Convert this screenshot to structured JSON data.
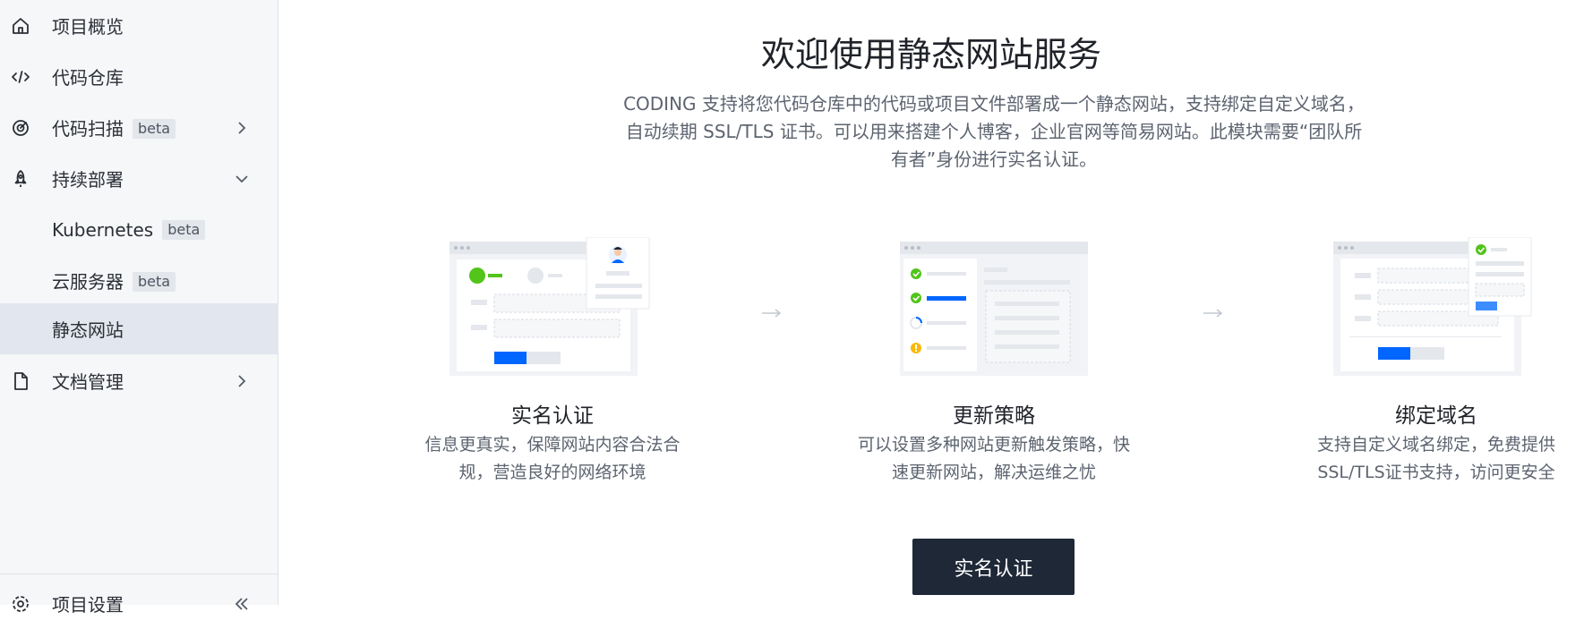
{
  "sidebar": {
    "items": [
      {
        "label": "项目概览",
        "icon": "home-icon"
      },
      {
        "label": "代码仓库",
        "icon": "code-icon"
      },
      {
        "label": "代码扫描",
        "badge": "beta",
        "icon": "scan-icon"
      },
      {
        "label": "持续部署",
        "icon": "rocket-icon"
      },
      {
        "label": "Kubernetes",
        "badge": "beta"
      },
      {
        "label": "云服务器",
        "badge": "beta"
      },
      {
        "label": "静态网站",
        "active": true
      },
      {
        "label": "文档管理",
        "icon": "document-icon"
      },
      {
        "label": "项目设置",
        "icon": "settings-icon"
      }
    ]
  },
  "main": {
    "title": "欢迎使用静态网站服务",
    "intro": "CODING 支持将您代码仓库中的代码或项目文件部署成一个静态网站，支持绑定自定义域名，自动续期 SSL/TLS 证书。可以用来搭建个人博客，企业官网等简易网站。此模块需要“团队所有者”身份进行实名认证。",
    "features": [
      {
        "title": "实名认证",
        "desc": "信息更真实，保障网站内容合法合规，营造良好的网络环境"
      },
      {
        "title": "更新策略",
        "desc": "可以设置多种网站更新触发策略，快速更新网站，解决运维之忧"
      },
      {
        "title": "绑定域名",
        "desc": "支持自定义域名绑定，免费提供 SSL/TLS证书支持，访问更安全"
      }
    ],
    "cta_label": "实名认证"
  },
  "colors": {
    "accent": "#0066ff",
    "success": "#52c41a",
    "warning": "#fab80a",
    "cta_bg": "#1e2837",
    "sidebar_bg": "#f6f7f9",
    "active_bg": "#e2e6ee"
  }
}
